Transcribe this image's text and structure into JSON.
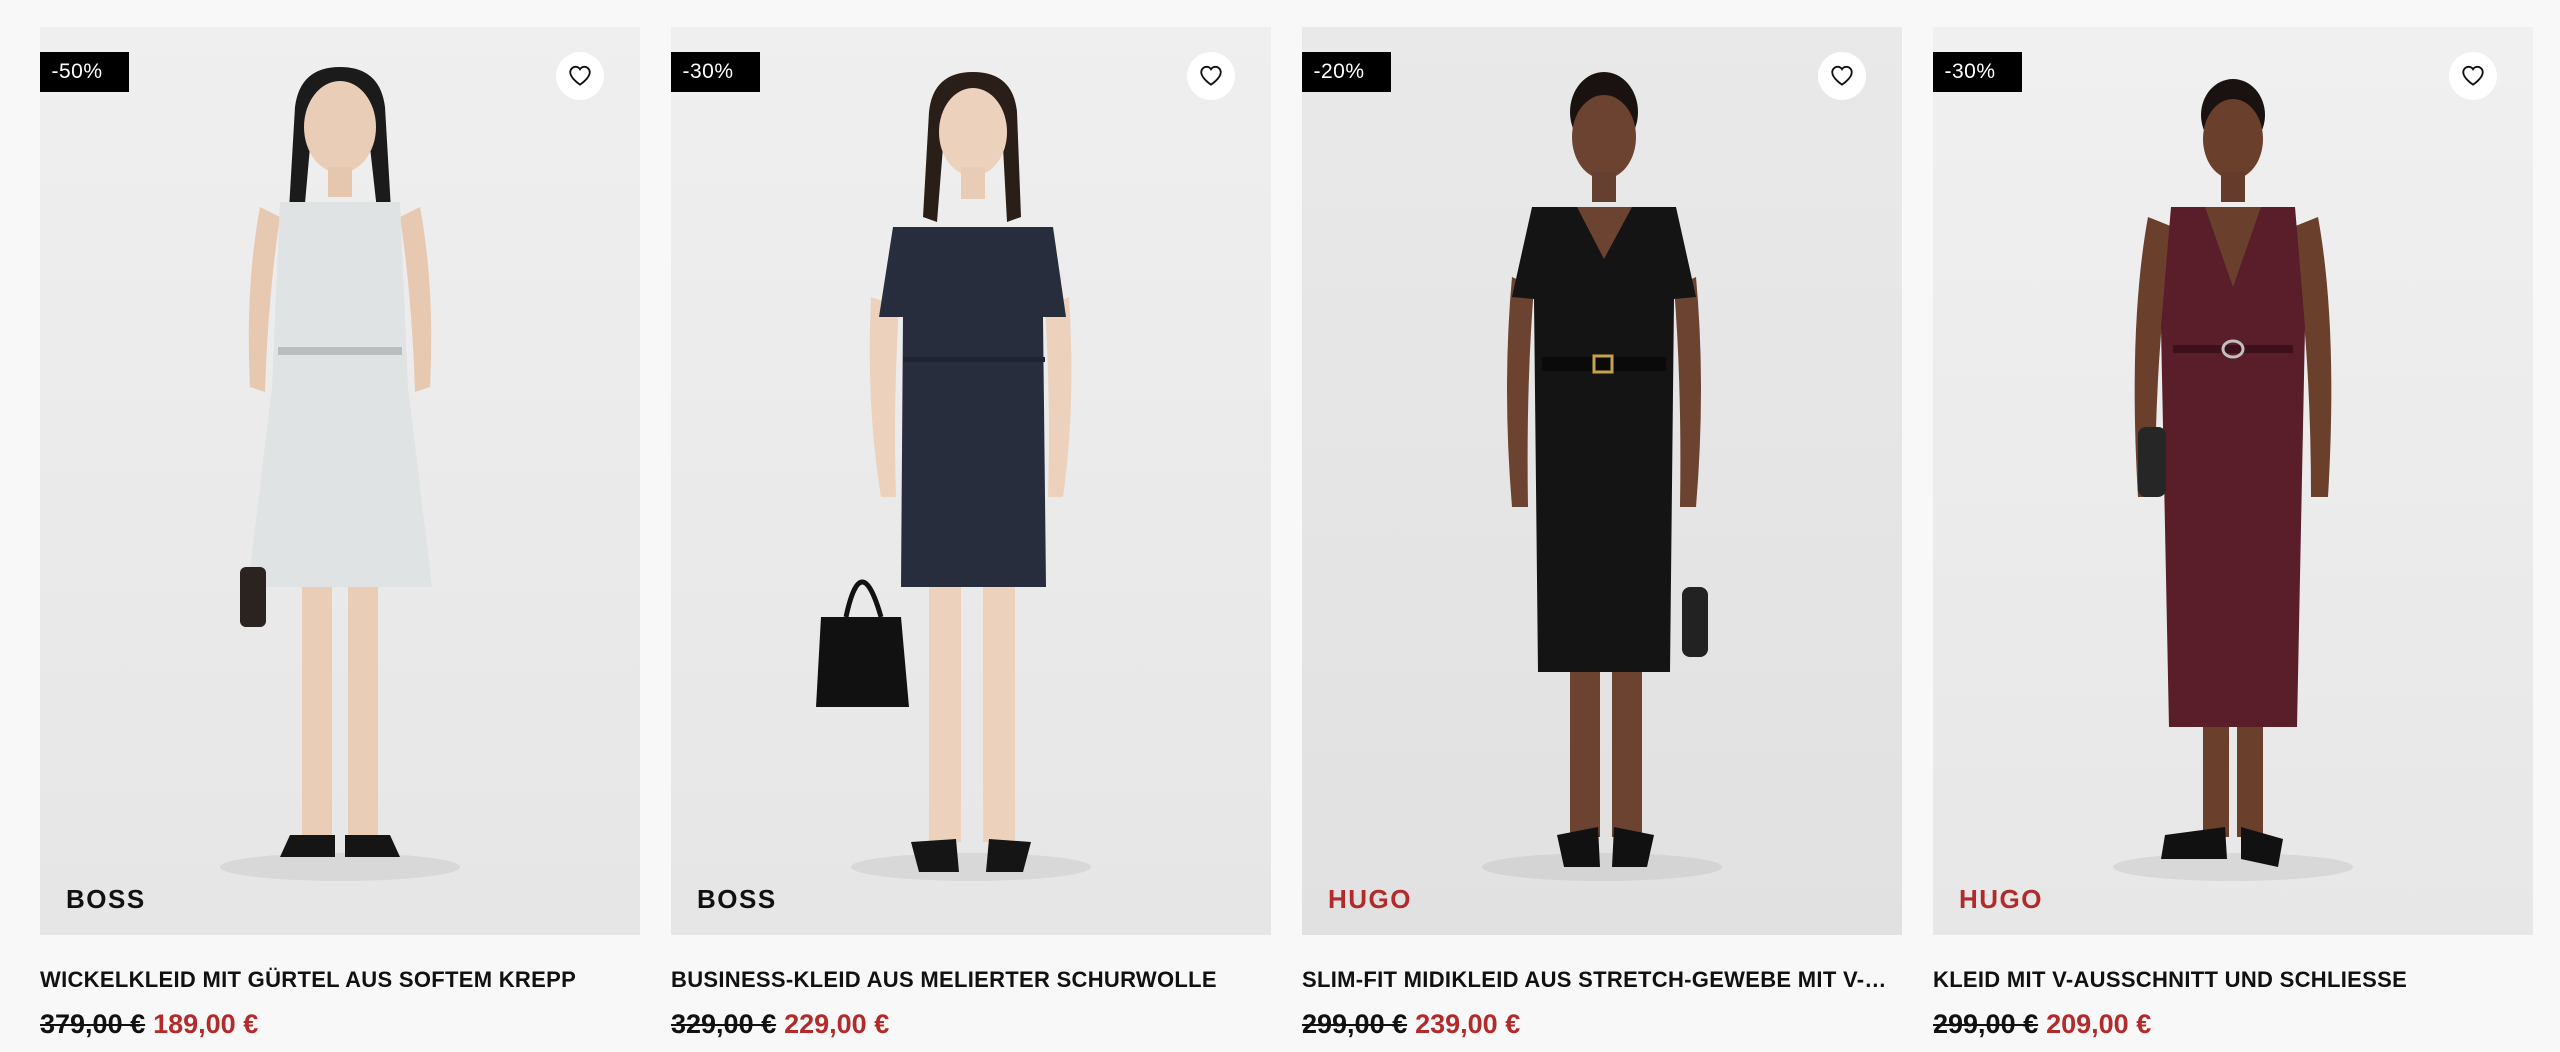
{
  "colors": {
    "sale_red": "#b32a2a",
    "badge_bg": "#000000",
    "page_bg": "#f8f8f8"
  },
  "products": [
    {
      "discount": "-50%",
      "brand": "BOSS",
      "title": "WICKELKLEID MIT GÜRTEL AUS SOFTEM KREPP",
      "old_price": "379,00 €",
      "new_price": "189,00 €",
      "dress_color": "#dfe3e3",
      "favorite_icon": "heart-outline-icon"
    },
    {
      "discount": "-30%",
      "brand": "BOSS",
      "title": "BUSINESS-KLEID AUS MELIERTER SCHURWOLLE",
      "old_price": "329,00 €",
      "new_price": "229,00 €",
      "dress_color": "#272d3d",
      "favorite_icon": "heart-outline-icon"
    },
    {
      "discount": "-20%",
      "brand": "HUGO",
      "title": "SLIM-FIT MIDIKLEID AUS STRETCH-GEWEBE MIT V-AUSSCHNITT",
      "old_price": "299,00 €",
      "new_price": "239,00 €",
      "dress_color": "#141414",
      "favorite_icon": "heart-outline-icon"
    },
    {
      "discount": "-30%",
      "brand": "HUGO",
      "title": "KLEID MIT V-AUSSCHNITT UND SCHLIESSE",
      "old_price": "299,00 €",
      "new_price": "209,00 €",
      "dress_color": "#5a1d2a",
      "favorite_icon": "heart-outline-icon"
    }
  ]
}
